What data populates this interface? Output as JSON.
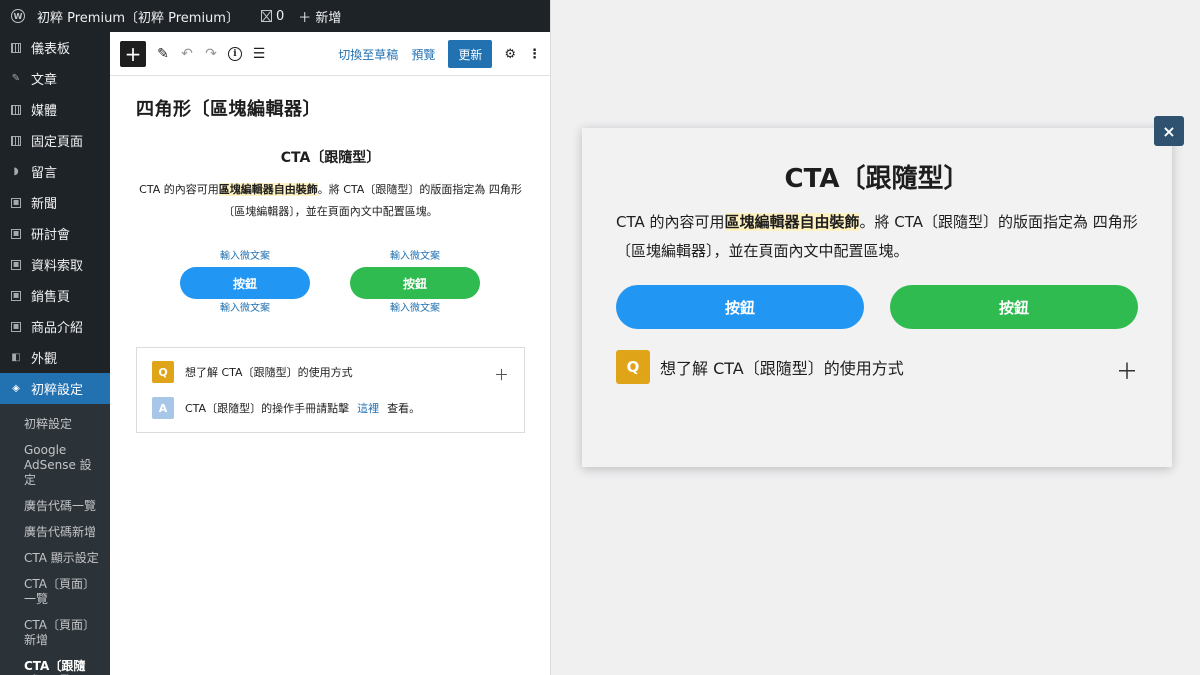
{
  "adminbar": {
    "logo": "W",
    "site_title": "初粹 Premium〔初粹 Premium〕",
    "comments_count": "0",
    "new_label": "＋ 新增"
  },
  "sidebar": {
    "items": [
      {
        "icon": "dashboard-icon",
        "label": "儀表板"
      },
      {
        "icon": "pin-icon",
        "label": "文章"
      },
      {
        "icon": "media-icon",
        "label": "媒體"
      },
      {
        "icon": "page-icon",
        "label": "固定頁面"
      },
      {
        "icon": "comment-icon",
        "label": "留言"
      },
      {
        "icon": "news-icon",
        "label": "新聞"
      },
      {
        "icon": "seminar-icon",
        "label": "研討會"
      },
      {
        "icon": "document-icon",
        "label": "資料索取"
      },
      {
        "icon": "sales-icon",
        "label": "銷售頁"
      },
      {
        "icon": "product-icon",
        "label": "商品介紹"
      },
      {
        "icon": "appearance-icon",
        "label": "外觀"
      },
      {
        "icon": "diamond-icon",
        "label": "初粹設定",
        "active": true
      }
    ],
    "submenu": [
      "初粹設定",
      "Google AdSense 設定",
      "廣告代碼一覽",
      "廣告代碼新增",
      "CTA 顯示設定",
      "CTA〔頁面〕一覽",
      "CTA〔頁面〕新增",
      "CTA〔跟隨型〕一覽"
    ]
  },
  "toolbar": {
    "add_label": "+",
    "switch_draft": "切換至草稿",
    "preview": "預覽",
    "update": "更新"
  },
  "editor": {
    "title": "四角形〔區塊編輯器〕",
    "cta_title": "CTA〔跟隨型〕",
    "desc_before": "CTA 的內容可用",
    "desc_highlight": "區塊編輯器自由裝飾",
    "desc_after": "。將 CTA〔跟隨型〕的版面指定為 四角形〔區塊編輯器〕，並在頁面內文中配置區塊。",
    "buttons": [
      {
        "micro_top": "輸入微文案",
        "label": "按鈕",
        "micro_bottom": "輸入微文案",
        "color": "#2196f3"
      },
      {
        "micro_top": "輸入微文案",
        "label": "按鈕",
        "micro_bottom": "輸入微文案",
        "color": "#2fbb4f"
      }
    ],
    "faq": {
      "q_badge": "Q",
      "question": "想了解 CTA〔跟隨型〕的使用方式",
      "a_badge": "A",
      "answer_before": "CTA〔跟隨型〕的操作手冊請點擊",
      "answer_link": "這裡",
      "answer_after": "查看。"
    }
  },
  "modal": {
    "close_label": "×",
    "title": "CTA〔跟隨型〕",
    "desc_before": "CTA 的內容可用",
    "desc_highlight": "區塊編輯器自由裝飾",
    "desc_after": "。將 CTA〔跟隨型〕的版面指定為 四角形〔區塊編輯器〕，並在頁面內文中配置區塊。",
    "button_blue": "按鈕",
    "button_green": "按鈕",
    "faq_badge": "Q",
    "faq_question": "想了解 CTA〔跟隨型〕的使用方式"
  },
  "colors": {
    "admin_dark": "#1d2327",
    "accent_blue": "#2271b1",
    "cta_blue": "#2196f3",
    "cta_green": "#2fbb4f",
    "faq_gold": "#dfa418",
    "close_navy": "#2f5271"
  }
}
